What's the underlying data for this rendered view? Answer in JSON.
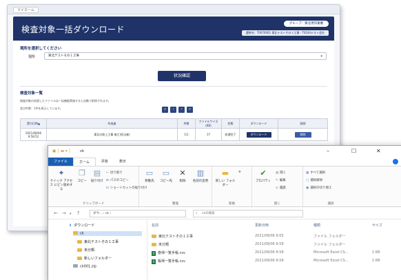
{
  "web": {
    "tab_label": "マイホーム",
    "page_title": "検査対象一括ダウンロード",
    "group_badge": "グループ：東北現作業機",
    "org_line": "選挙名：T0070001 東北テストその１工事 - T0244テスト会社",
    "section_site": "現所を選択してください",
    "site_label": "現所",
    "site_value": "東北テストその１工事",
    "status_button": "状況確認",
    "section_list": "検査対象一覧",
    "note1": "検査対象の処理したファイルは一括機能実施すると自動で削除されます。",
    "note2": "並び件数：1件を表示しています。",
    "pager": [
      "«",
      "‹",
      "›",
      "»"
    ],
    "table": {
      "headers": [
        "受付日時▲",
        "作成者",
        "件数",
        "ファイルサイズ(KB)",
        "状態",
        "ダウンロード",
        "削除"
      ],
      "rows": [
        [
          "2021/08/06 9:58:52",
          "東北の陸上工事 施工(担当者)",
          "1/1",
          "37",
          "処理完了",
          "ダウンロード",
          "削除"
        ]
      ]
    }
  },
  "explorer": {
    "title": "ck",
    "window_controls": [
      "–",
      "☐",
      "✕"
    ],
    "ribbon_tabs": [
      "ファイル",
      "ホーム",
      "共有",
      "表示"
    ],
    "ribbon": {
      "clipboard": {
        "pin": "クイック アクセス にピン留めする",
        "copy": "コピー",
        "paste": "貼り付け",
        "cut": "切り取り",
        "copy_path": "パスのコピー",
        "paste_shortcut": "ショートカットの貼り付け",
        "label": "クリップボード"
      },
      "organize": {
        "move_to": "移動先",
        "copy_to": "コピー先",
        "delete": "削除",
        "rename": "名前の変更",
        "label": "整理"
      },
      "new": {
        "new_folder": "新しい フォルダー",
        "label": "新規"
      },
      "open": {
        "properties": "プロパティ",
        "open": "開く",
        "edit": "編集",
        "history": "履歴",
        "label": "開く"
      },
      "select": {
        "select_all": "すべて選択",
        "select_none": "選択解除",
        "invert": "選択の切り替え",
        "label": "選択"
      }
    },
    "address": "ダウ... › ck ›",
    "search_placeholder": "ckの検索",
    "nav": [
      {
        "label": "ダウンロード"
      },
      {
        "label": "ck"
      },
      {
        "label": "東北テストその１工事"
      },
      {
        "label": "未分類"
      },
      {
        "label": "新しいフォルダー"
      },
      {
        "label": "ck001.zip"
      }
    ],
    "columns": [
      "名前",
      "更新日時",
      "種類",
      "サイズ"
    ],
    "files": [
      {
        "name": "東北テストその１工事",
        "date": "2021/08/06 9:05",
        "type": "ファイル フォルダー",
        "size": "",
        "kind": "folder"
      },
      {
        "name": "未分類",
        "date": "2021/08/06 9:58",
        "type": "ファイル フォルダー",
        "size": "",
        "kind": "folder"
      },
      {
        "name": "巻帰一覧手帳.csv",
        "date": "2021/08/06 8:58",
        "type": "Microsoft Excel CS...",
        "size": "1 KB",
        "kind": "excel"
      },
      {
        "name": "帳帰一覧手帳.csv",
        "date": "2021/08/06 8:58",
        "type": "Microsoft Excel CS...",
        "size": "1 KB",
        "kind": "excel"
      }
    ]
  }
}
